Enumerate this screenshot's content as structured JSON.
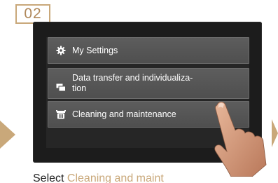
{
  "step": {
    "number": "02"
  },
  "menu": {
    "items": [
      {
        "label": "My Settings",
        "icon": "gear-icon"
      },
      {
        "label": "Data transfer and individualiza-\ntion",
        "icon": "data-transfer-icon"
      },
      {
        "label": "Cleaning and maintenance",
        "icon": "cleaning-icon"
      }
    ]
  },
  "caption": {
    "prefix": "Select ",
    "highlight": "Cleaning and maint"
  },
  "colors": {
    "accent": "#c9a87a",
    "screen": "#1c1c1c",
    "button": "#555555"
  }
}
